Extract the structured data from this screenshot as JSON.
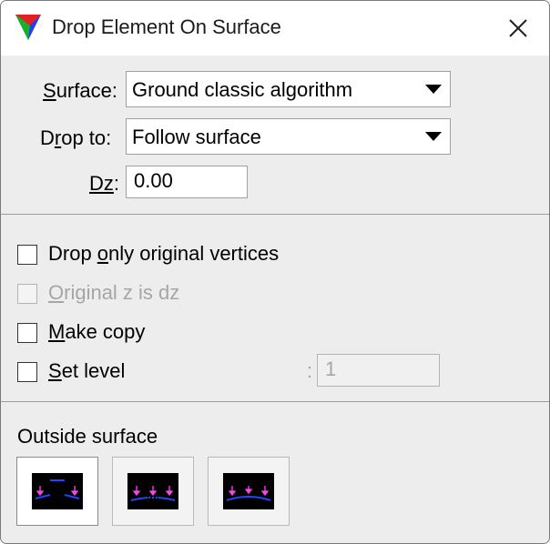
{
  "window": {
    "title": "Drop Element On Surface",
    "icon": "terrasolid-triangle-icon",
    "close_icon": "close-icon"
  },
  "fields": {
    "surface": {
      "label": "Surface",
      "label_underline": "S",
      "value": "Ground classic algorithm"
    },
    "drop_to": {
      "label": "Drop to",
      "value": "Follow surface"
    },
    "dz": {
      "label": "Dz",
      "value": "0.00"
    }
  },
  "checkboxes": [
    {
      "label": "Drop only original vertices",
      "checked": false,
      "enabled": true
    },
    {
      "label": "Original z is dz",
      "checked": false,
      "enabled": false
    },
    {
      "label": "Make copy",
      "checked": false,
      "enabled": true
    },
    {
      "label": "Set level",
      "checked": false,
      "enabled": true
    }
  ],
  "set_level": {
    "value": "1",
    "enabled": false
  },
  "outside_surface": {
    "label": "Outside surface",
    "options": [
      {
        "name": "keep-original-icon",
        "selected": true
      },
      {
        "name": "drop-to-nearest-icon",
        "selected": false
      },
      {
        "name": "drop-to-extended-icon",
        "selected": false
      }
    ]
  },
  "colors": {
    "window_bg": "#ededed",
    "title_bg": "#ffffff",
    "icon_blue": "#1b39ff",
    "icon_magenta": "#ff3cf0"
  }
}
